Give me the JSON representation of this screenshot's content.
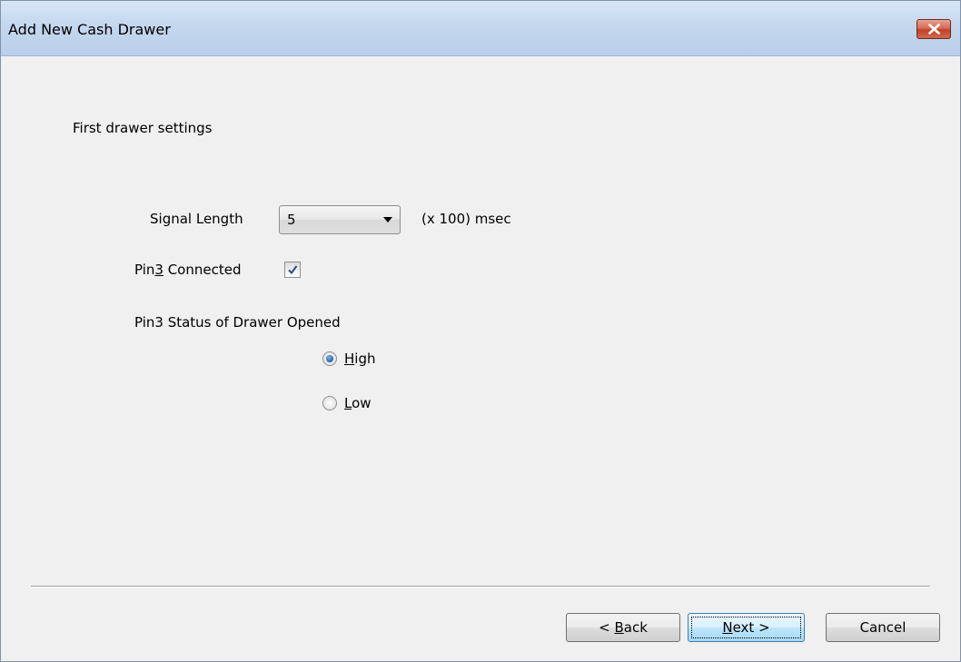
{
  "window": {
    "title": "Add New Cash Drawer"
  },
  "icons": {
    "close": "close-icon",
    "dropdown": "chevron-down-icon",
    "check": "checkmark-icon"
  },
  "colors": {
    "close_button": "#c24129",
    "titlebar": "#c4d7ee",
    "background": "#f0f0f0",
    "radio_selected": "#1f5ea8",
    "default_button_border": "#3c7fb1"
  },
  "form": {
    "section_heading": "First drawer settings",
    "signal_length": {
      "label": "Signal Length",
      "value": "5",
      "unit": "(x 100) msec"
    },
    "pin3_connected": {
      "label_prefix": "Pin",
      "label_accel": "3",
      "label_suffix": " Connected",
      "checked": true
    },
    "pin3_status": {
      "heading": "Pin3 Status of Drawer Opened",
      "selected": "High",
      "options": [
        {
          "accel": "H",
          "rest": "igh"
        },
        {
          "accel": "L",
          "rest": "ow"
        }
      ]
    }
  },
  "buttons": {
    "back": {
      "prefix": "< ",
      "accel": "B",
      "rest": "ack"
    },
    "next": {
      "accel": "N",
      "rest": "ext >"
    },
    "cancel": "Cancel"
  }
}
